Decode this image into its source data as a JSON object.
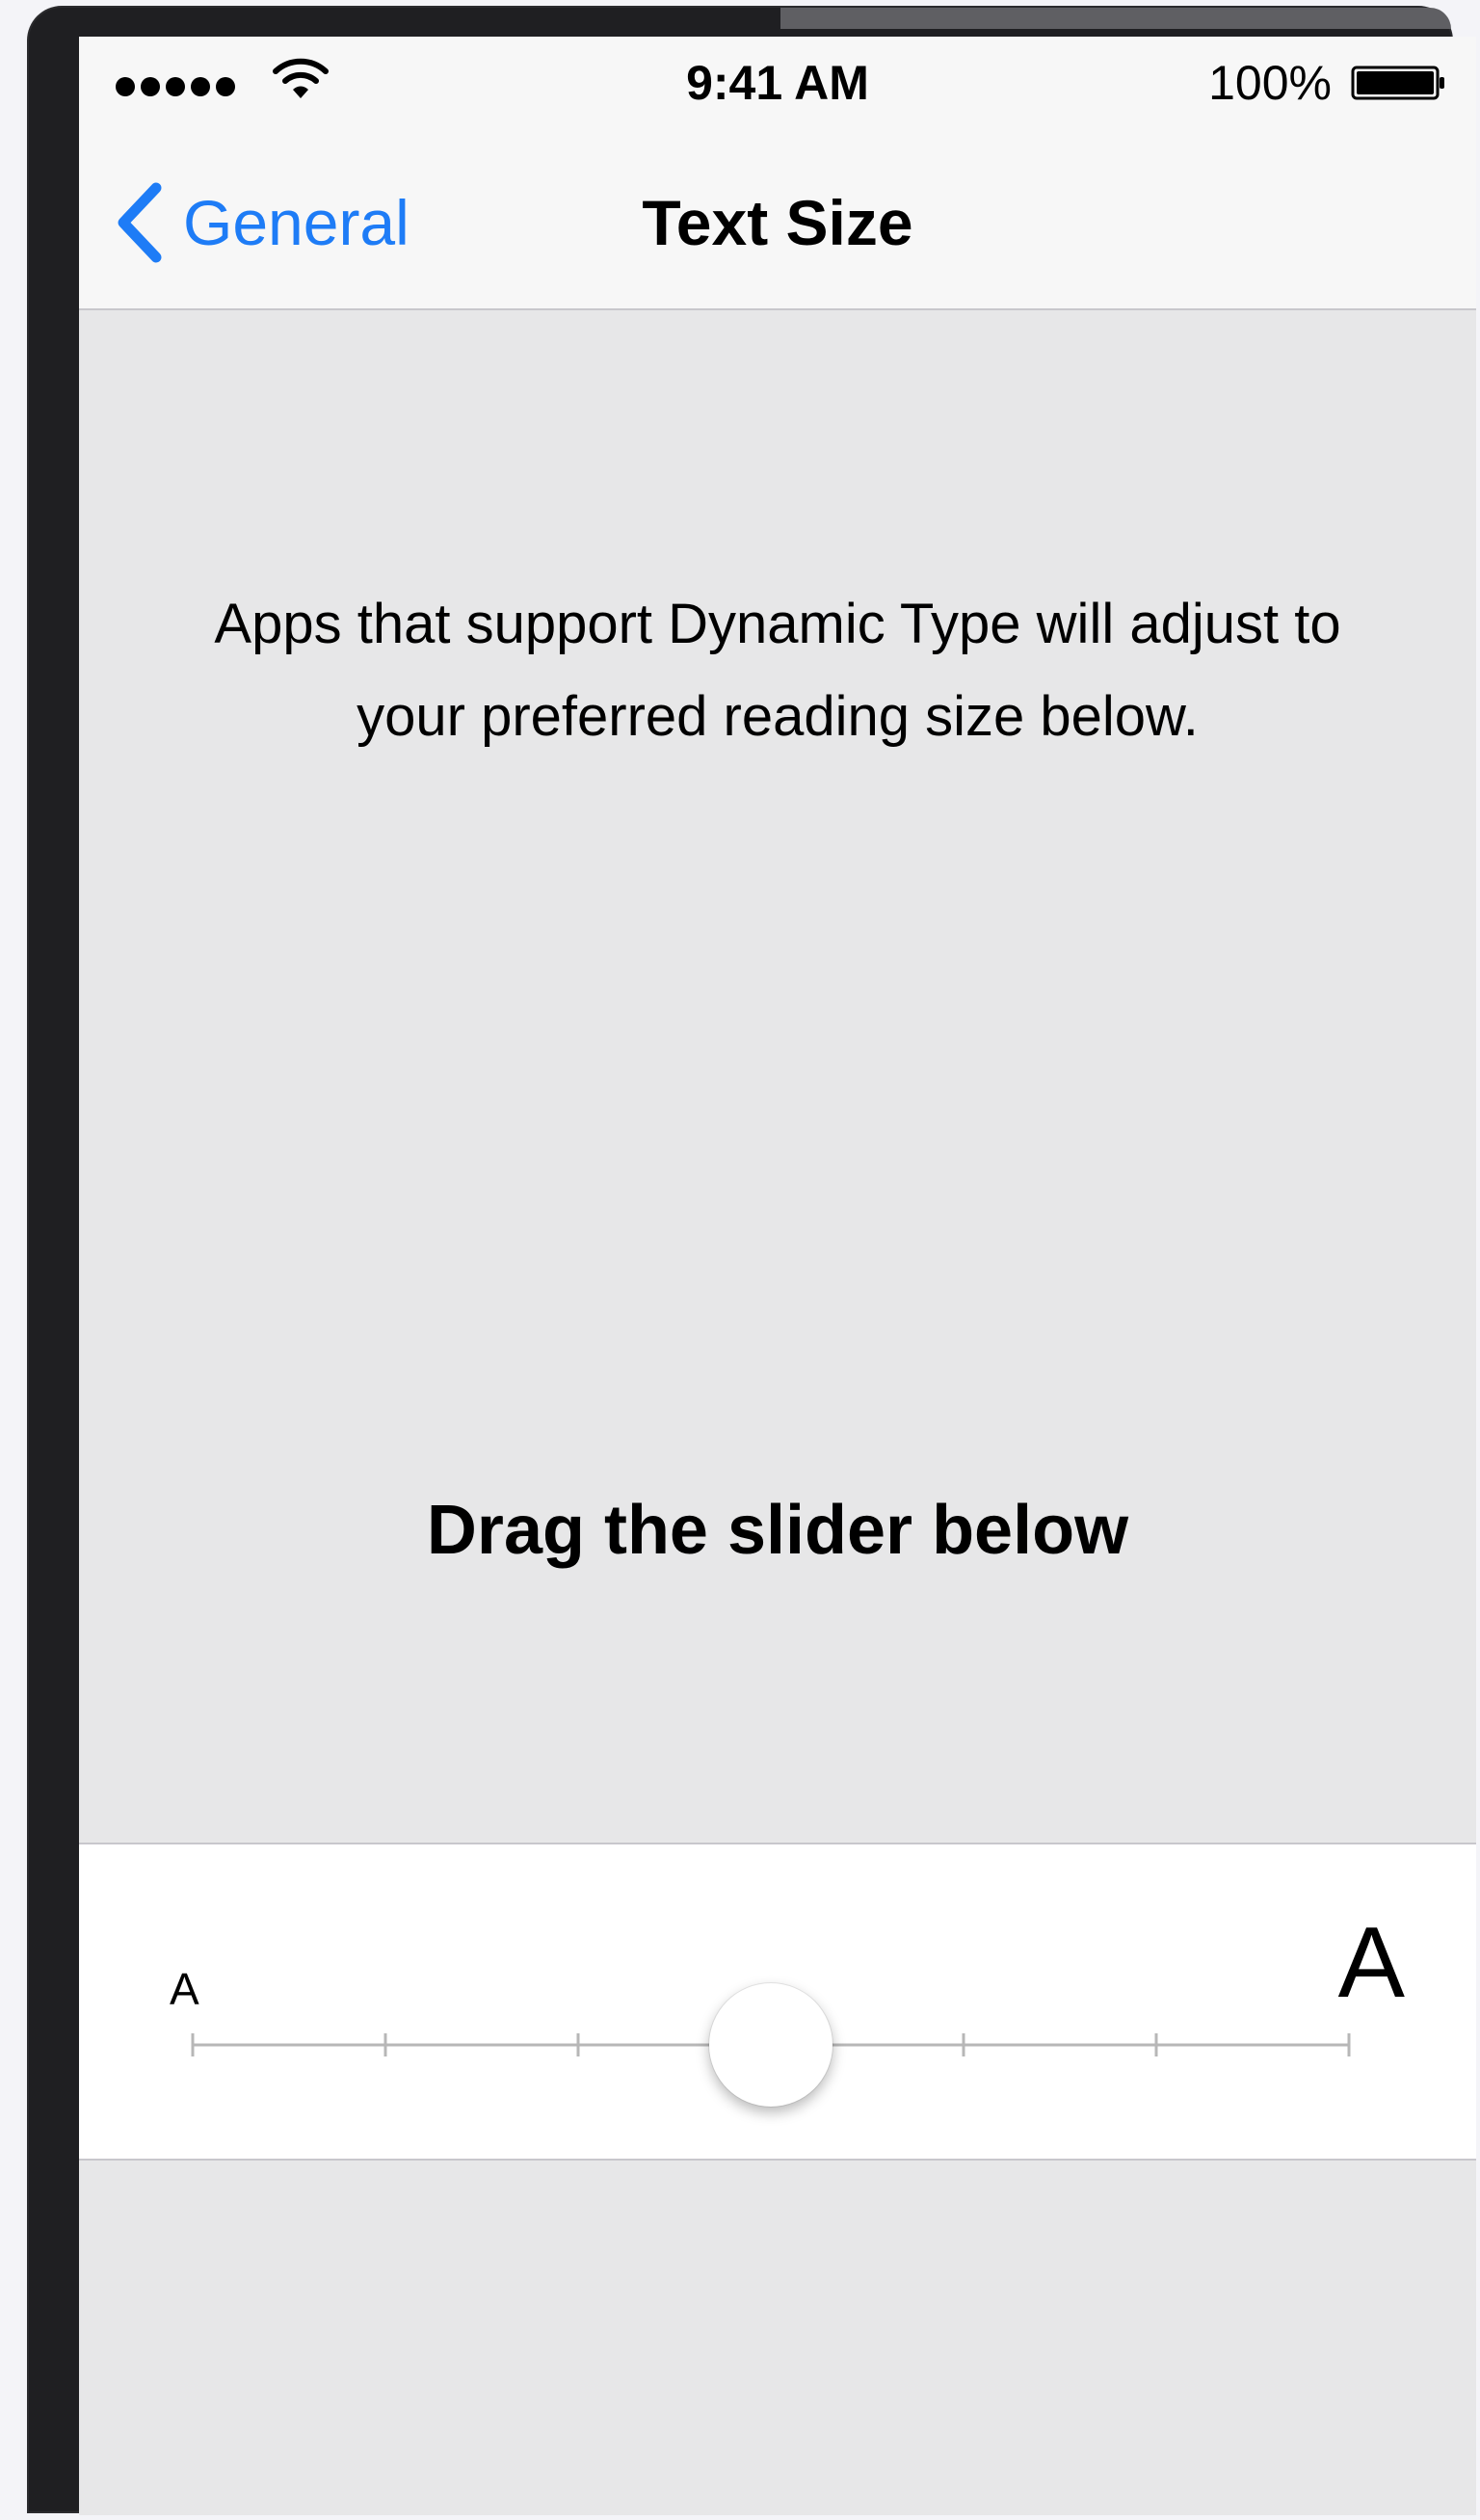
{
  "status_bar": {
    "time": "9:41 AM",
    "battery_percent": "100%",
    "signal_bars": 5,
    "icons": [
      "signal-dots-icon",
      "wifi-icon",
      "battery-icon"
    ]
  },
  "nav_bar": {
    "back_label": "General",
    "title": "Text Size",
    "back_icon": "chevron-left-icon"
  },
  "content": {
    "description": "Apps that support Dynamic Type will adjust to your preferred reading size below.",
    "preview_text": "Drag the slider below"
  },
  "slider": {
    "small_label": "A",
    "large_label": "A",
    "steps": 7,
    "selected_step": 4
  },
  "colors": {
    "accent": "#1e7cf6",
    "background": "#e7e7e8",
    "bar": "#f7f7f7",
    "separator": "#c8c7cc",
    "track": "#b7b7b7"
  }
}
